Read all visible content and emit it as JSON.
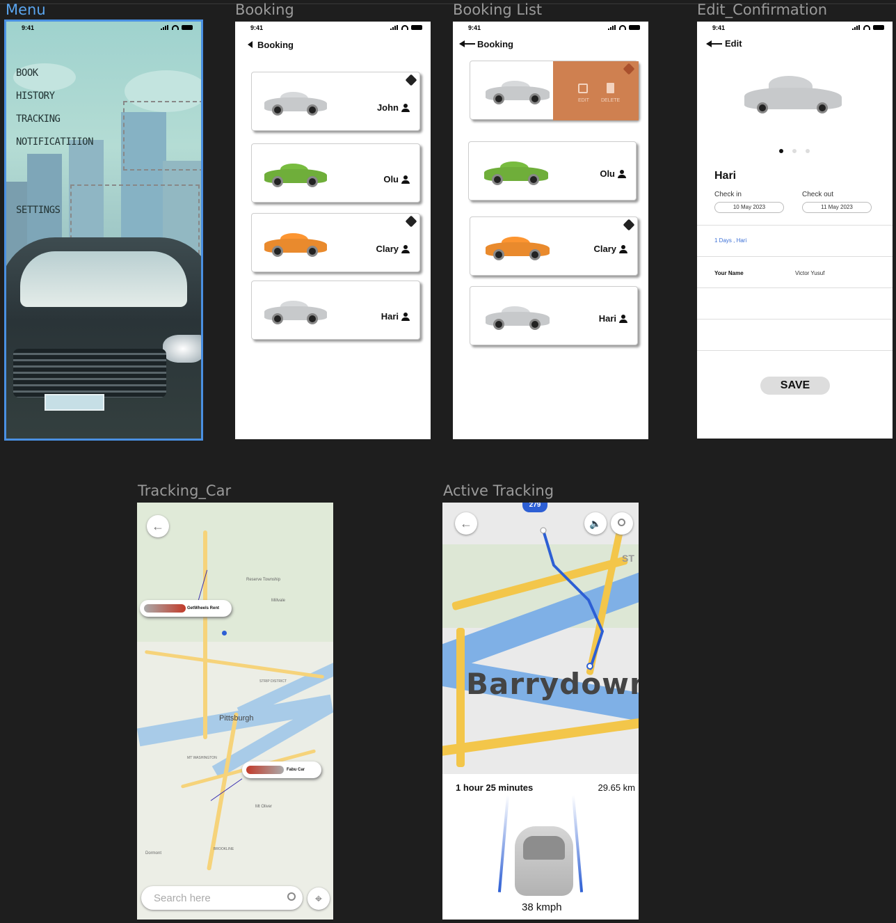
{
  "frames": {
    "menu": "Menu",
    "booking": "Booking",
    "booking_list": "Booking List",
    "edit_confirmation": "Edit_Confirmation",
    "tracking_car": "Tracking_Car",
    "active_tracking": "Active Tracking"
  },
  "status_time": "9:41",
  "menu": {
    "items": [
      "BOOK",
      "HISTORY",
      "TRACKING",
      "NOTIFICATIIION",
      "SETTINGS"
    ]
  },
  "booking": {
    "title": "Booking",
    "cards": [
      {
        "name": "John",
        "car_color": "#c7c9cb",
        "tag": true
      },
      {
        "name": "Olu",
        "car_color": "#6fae3a",
        "tag": false
      },
      {
        "name": "Clary",
        "car_color": "#e98a2d",
        "tag": true
      },
      {
        "name": "Hari",
        "car_color": "#c7c9cb",
        "tag": false
      }
    ]
  },
  "booking_list": {
    "title": "Booking",
    "edit_label": "EDIT",
    "delete_label": "DELETE",
    "cards": [
      {
        "name": "",
        "car_color": "#c7c9cb"
      },
      {
        "name": "Olu",
        "car_color": "#6fae3a"
      },
      {
        "name": "Clary",
        "car_color": "#e98a2d"
      },
      {
        "name": "Hari",
        "car_color": "#c7c9cb"
      }
    ]
  },
  "edit": {
    "title": "Edit",
    "name": "Hari",
    "check_in_label": "Check in",
    "check_in": "10 May 2023",
    "check_out_label": "Check out",
    "check_out": "11 May 2023",
    "days": "1 Days ,  Hari",
    "your_name_label": "Your Name",
    "your_name": "Victor Yusuf",
    "save": "SAVE",
    "accent": "#3b6fd6"
  },
  "tracking": {
    "map_labels": [
      "Pittsburgh",
      "Reserve Township",
      "Millvale",
      "Mt Oliver",
      "Dormont",
      "STRIP DISTRICT",
      "MT WASHINGTON",
      "BROOKLINE"
    ],
    "callout_1": "GetWheels Rent",
    "callout_2": "Fabu Car",
    "search_placeholder": "Search here"
  },
  "active": {
    "place": "Barrydowne",
    "highway": "279",
    "duration": "1 hour 25 minutes",
    "distance": "29.65 km",
    "speed": "38 kmph",
    "street_hint": "ST",
    "route_color": "#2d5fd4"
  }
}
